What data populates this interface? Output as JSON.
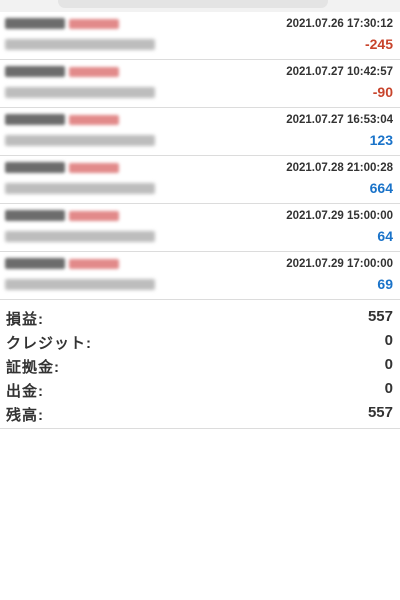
{
  "trades": [
    {
      "time": "2021.07.26 17:30:12",
      "profit": "-245",
      "sign": "neg"
    },
    {
      "time": "2021.07.27 10:42:57",
      "profit": "-90",
      "sign": "neg"
    },
    {
      "time": "2021.07.27 16:53:04",
      "profit": "123",
      "sign": "pos"
    },
    {
      "time": "2021.07.28 21:00:28",
      "profit": "664",
      "sign": "pos"
    },
    {
      "time": "2021.07.29 15:00:00",
      "profit": "64",
      "sign": "pos"
    },
    {
      "time": "2021.07.29 17:00:00",
      "profit": "69",
      "sign": "pos"
    }
  ],
  "summary": {
    "profit_label": "損益:",
    "profit_value": "557",
    "credit_label": "クレジット:",
    "credit_value": "0",
    "deposit_margin_label": "証拠金:",
    "deposit_margin_value": "0",
    "withdrawal_label": "出金:",
    "withdrawal_value": "0",
    "balance_label": "残高:",
    "balance_value": "557"
  },
  "colors": {
    "negative": "#c8442c",
    "positive": "#1a73c9"
  }
}
